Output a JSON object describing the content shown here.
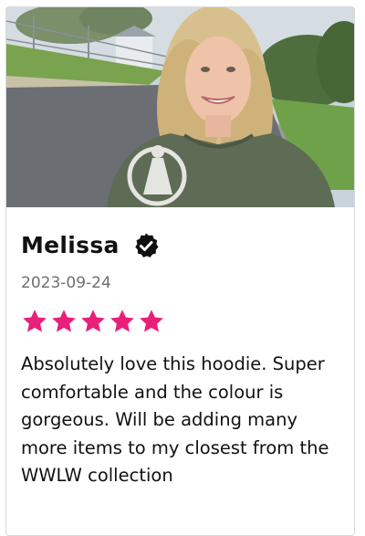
{
  "review": {
    "author": "Melissa",
    "verified_icon": "verified-check-icon",
    "date": "2023-09-24",
    "rating": 5,
    "rating_max": 5,
    "star_color": "#e8207a",
    "text": "Absolutely love this hoodie. Super comfortable and the colour is gorgeous. Will be adding many more items to my closest from the WWLW collection"
  },
  "photo": {
    "icon": "customer-selfie-image"
  }
}
